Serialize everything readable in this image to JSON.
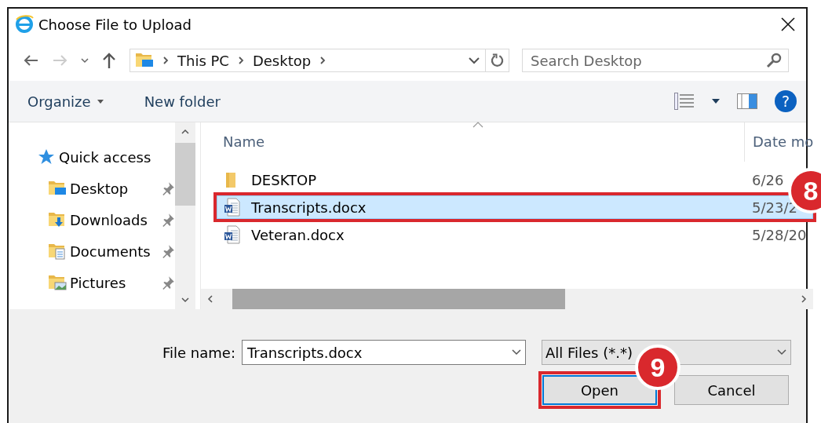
{
  "window": {
    "title": "Choose File to Upload"
  },
  "address": {
    "crumbs": [
      "This PC",
      "Desktop"
    ]
  },
  "search": {
    "placeholder": "Search Desktop"
  },
  "toolbar": {
    "organize": "Organize",
    "new_folder": "New folder",
    "help": "?"
  },
  "sidebar": {
    "items": [
      {
        "label": "Quick access",
        "kind": "star",
        "pinned": false
      },
      {
        "label": "Desktop",
        "kind": "desktop",
        "pinned": true
      },
      {
        "label": "Downloads",
        "kind": "downloads",
        "pinned": true
      },
      {
        "label": "Documents",
        "kind": "documents",
        "pinned": true
      },
      {
        "label": "Pictures",
        "kind": "pictures",
        "pinned": true
      }
    ]
  },
  "table": {
    "columns": [
      "Name",
      "Date mo"
    ],
    "rows": [
      {
        "name": "DESKTOP",
        "date": "6/26",
        "kind": "folder",
        "selected": false
      },
      {
        "name": "Transcripts.docx",
        "date": "5/23/2",
        "kind": "word",
        "selected": true
      },
      {
        "name": "Veteran.docx",
        "date": "5/28/20",
        "kind": "word",
        "selected": false
      }
    ]
  },
  "file_name": {
    "label": "File name:",
    "value": "Transcripts.docx"
  },
  "filter": {
    "value": "All Files (*.*)"
  },
  "buttons": [
    "Open",
    "Cancel"
  ],
  "annotations": [
    {
      "label": "8"
    },
    {
      "label": "9"
    }
  ]
}
